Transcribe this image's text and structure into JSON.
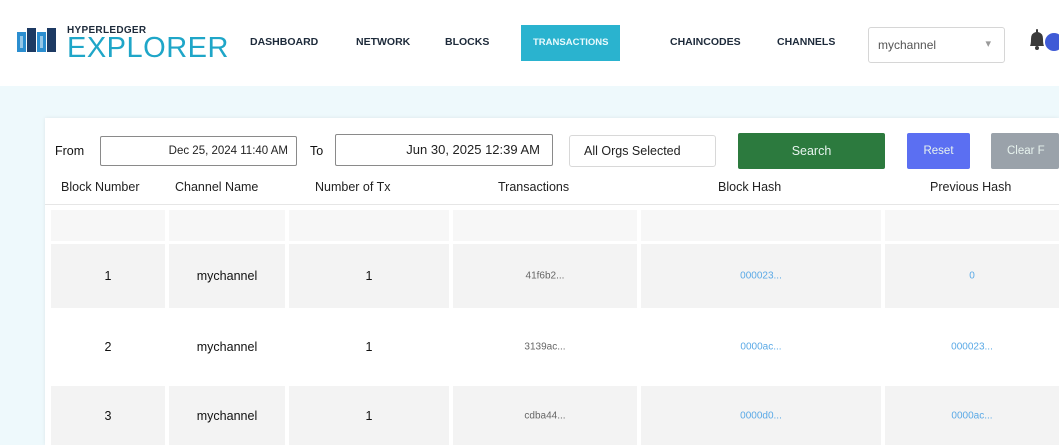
{
  "header": {
    "logo_small": "HYPERLEDGER",
    "logo_big": "EXPLORER",
    "nav": [
      {
        "label": "DASHBOARD"
      },
      {
        "label": "NETWORK"
      },
      {
        "label": "BLOCKS"
      },
      {
        "label": "TRANSACTIONS",
        "active": true
      },
      {
        "label": "CHAINCODES"
      },
      {
        "label": "CHANNELS"
      }
    ],
    "channel_select": {
      "value": "mychannel"
    },
    "notification_icon": "bell-icon"
  },
  "filters": {
    "from_label": "From",
    "from_value": "Dec 25, 2024 11:40 AM",
    "to_label": "To",
    "to_value": "Jun 30, 2025 12:39 AM",
    "orgs_value": "All Orgs Selected",
    "search_label": "Search",
    "reset_label": "Reset",
    "clear_label": "Clear F"
  },
  "table": {
    "columns": [
      "Block Number",
      "Channel Name",
      "Number of Tx",
      "Transactions",
      "Block Hash",
      "Previous Hash"
    ],
    "rows": [
      {
        "block_number": "1",
        "channel_name": "mychannel",
        "num_tx": "1",
        "transactions": "41f6b2...",
        "block_hash": "000023...",
        "previous_hash": "0"
      },
      {
        "block_number": "2",
        "channel_name": "mychannel",
        "num_tx": "1",
        "transactions": "3139ac...",
        "block_hash": "0000ac...",
        "previous_hash": "000023..."
      },
      {
        "block_number": "3",
        "channel_name": "mychannel",
        "num_tx": "1",
        "transactions": "cdba44...",
        "block_hash": "0000d0...",
        "previous_hash": "0000ac..."
      }
    ]
  },
  "colors": {
    "page_bg": "#eef9fc",
    "brand_blue": "#1fa6c8",
    "active_tab": "#2ab3cf",
    "search_button": "#2c7a3e",
    "reset_button": "#5b6ff2",
    "clear_button": "#9aa2aa",
    "hash_link": "#5aa9e6"
  }
}
